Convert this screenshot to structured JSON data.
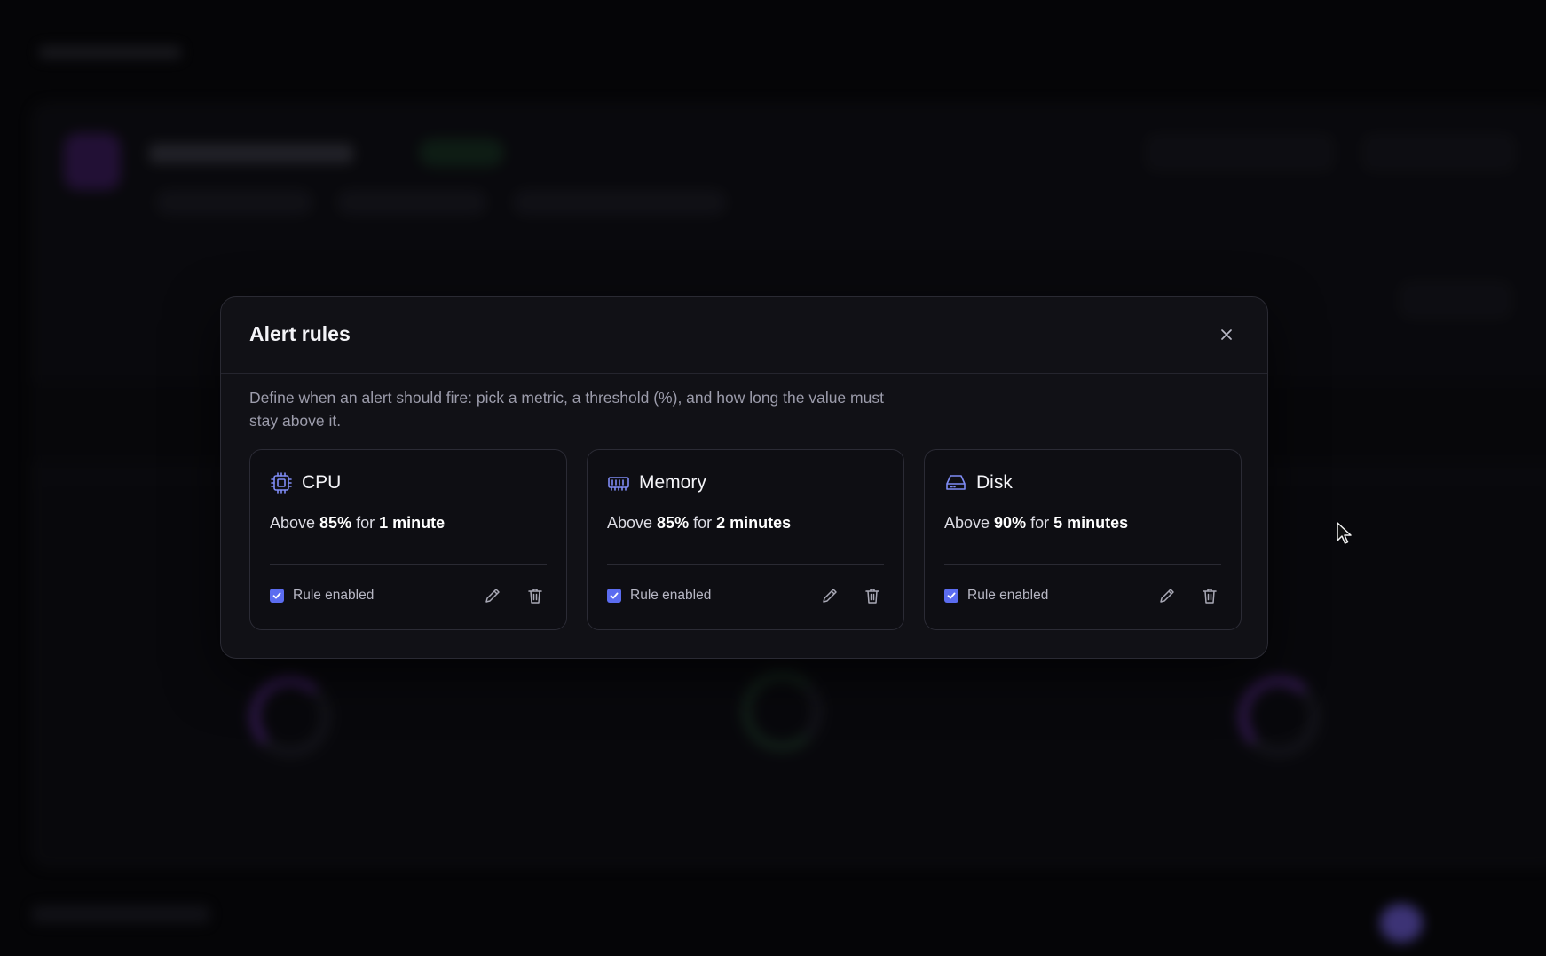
{
  "modal": {
    "title": "Alert rules",
    "description": "Define when an alert should fire: pick a metric, a threshold (%), and how long the value must stay above it.",
    "close_icon": "close-icon"
  },
  "rules": [
    {
      "metric": "CPU",
      "icon": "cpu-chip-icon",
      "prefix": "Above ",
      "threshold": "85%",
      "mid": " for ",
      "duration": "1 minute",
      "enabled": true,
      "enabled_label": "Rule enabled"
    },
    {
      "metric": "Memory",
      "icon": "memory-icon",
      "prefix": "Above ",
      "threshold": "85%",
      "mid": " for ",
      "duration": "2 minutes",
      "enabled": true,
      "enabled_label": "Rule enabled"
    },
    {
      "metric": "Disk",
      "icon": "disk-drive-icon",
      "prefix": "Above ",
      "threshold": "90%",
      "mid": " for ",
      "duration": "5 minutes",
      "enabled": true,
      "enabled_label": "Rule enabled"
    }
  ],
  "colors": {
    "accent": "#5b6cf0",
    "icon": "#7f8cf5",
    "modal_bg": "#111116",
    "page_bg": "#050507"
  }
}
